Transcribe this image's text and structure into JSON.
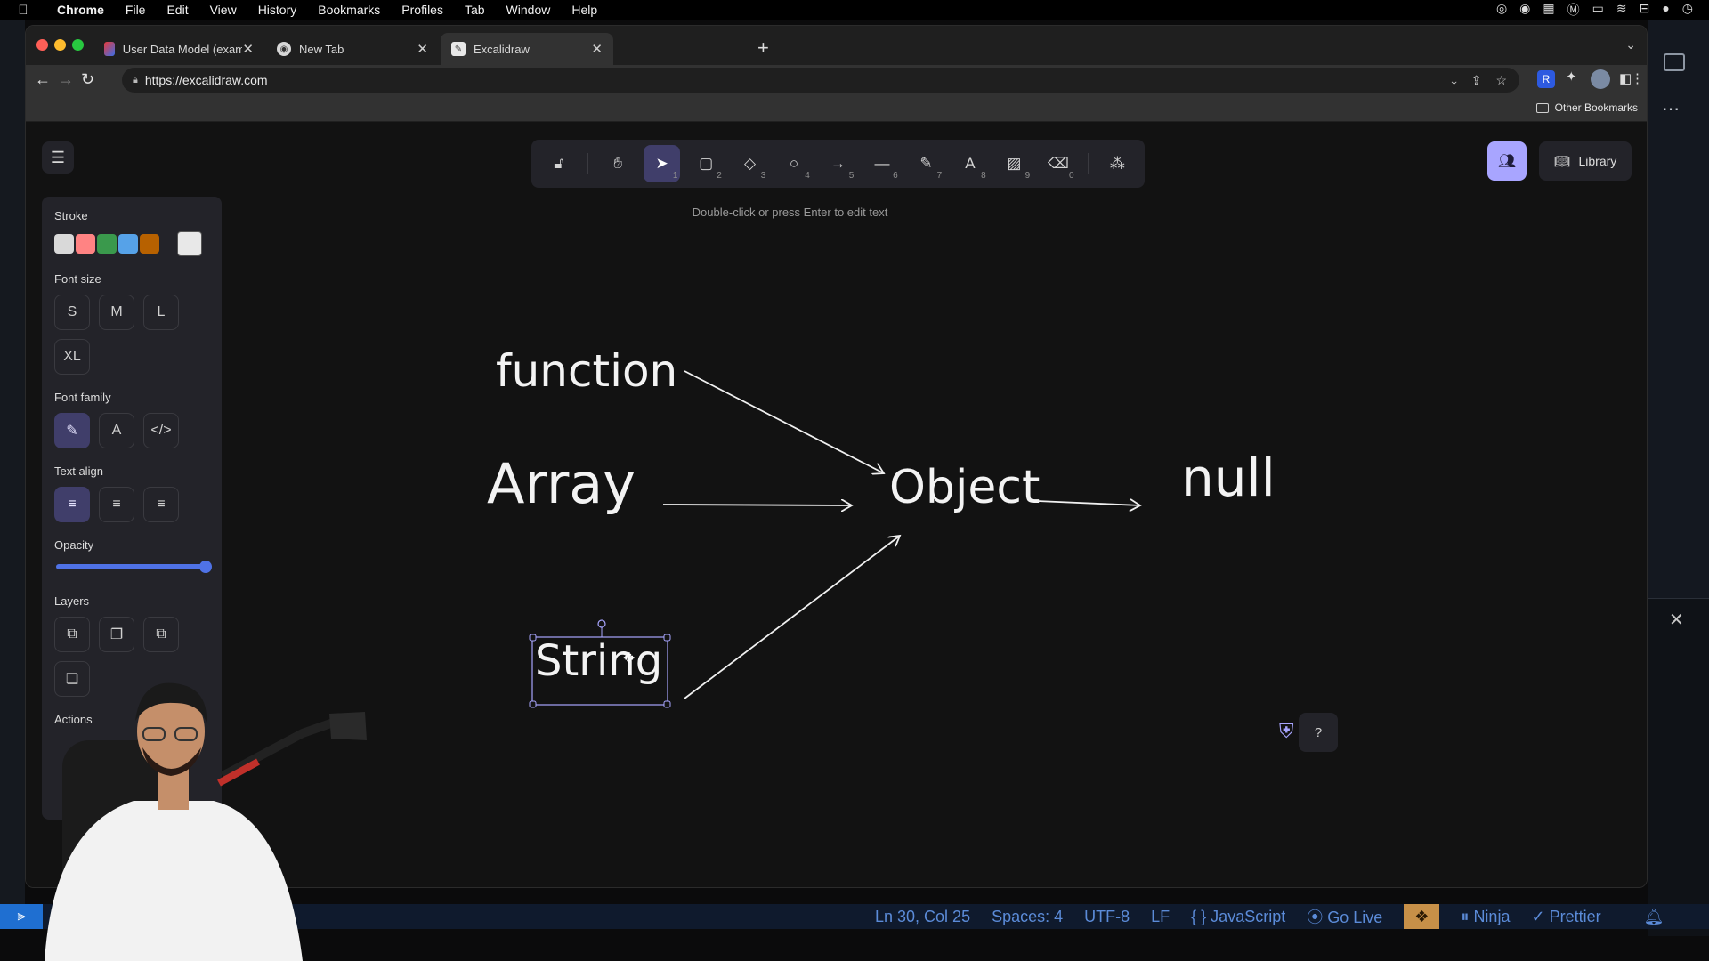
{
  "menubar": {
    "apple": "",
    "items": [
      "Chrome",
      "File",
      "Edit",
      "View",
      "History",
      "Bookmarks",
      "Profiles",
      "Tab",
      "Window",
      "Help"
    ]
  },
  "browser": {
    "tabs": [
      {
        "title": "User Data Model (example) — I"
      },
      {
        "title": "New Tab"
      },
      {
        "title": "Excalidraw"
      }
    ],
    "url": "https://excalidraw.com",
    "bookmarks": {
      "other": "Other Bookmarks"
    }
  },
  "excalidraw": {
    "tools": [
      {
        "name": "lock",
        "key": ""
      },
      {
        "name": "hand",
        "key": ""
      },
      {
        "name": "selection",
        "key": "1"
      },
      {
        "name": "rectangle",
        "key": "2"
      },
      {
        "name": "diamond",
        "key": "3"
      },
      {
        "name": "ellipse",
        "key": "4"
      },
      {
        "name": "arrow",
        "key": "5"
      },
      {
        "name": "line",
        "key": "6"
      },
      {
        "name": "draw",
        "key": "7"
      },
      {
        "name": "text",
        "key": "8"
      },
      {
        "name": "image",
        "key": "9"
      },
      {
        "name": "eraser",
        "key": "0"
      },
      {
        "name": "extra-tools",
        "key": ""
      }
    ],
    "hint": "Double-click or press Enter to edit text",
    "library_label": "Library",
    "props": {
      "stroke_label": "Stroke",
      "stroke_colors": [
        "#d9d9d9",
        "#ff8383",
        "#3a994c",
        "#56a2e8",
        "#b76100"
      ],
      "stroke_current": "#e8e8e8",
      "font_size_label": "Font size",
      "font_sizes": [
        "S",
        "M",
        "L",
        "XL"
      ],
      "font_family_label": "Font family",
      "text_align_label": "Text align",
      "opacity_label": "Opacity",
      "opacity_value": 100,
      "layers_label": "Layers",
      "actions_label": "Actions"
    },
    "canvas_words": {
      "function": "function",
      "array": "Array",
      "object": "Object",
      "null": "null",
      "string": "String"
    },
    "accent": "#a8a5ff"
  },
  "statusbar": {
    "position": "Ln 30, Col 25",
    "spaces": "Spaces: 4",
    "encoding": "UTF-8",
    "eol": "LF",
    "language": "{ } JavaScript",
    "golive": "Go Live",
    "ninja": "Ninja",
    "prettier": "Prettier"
  }
}
